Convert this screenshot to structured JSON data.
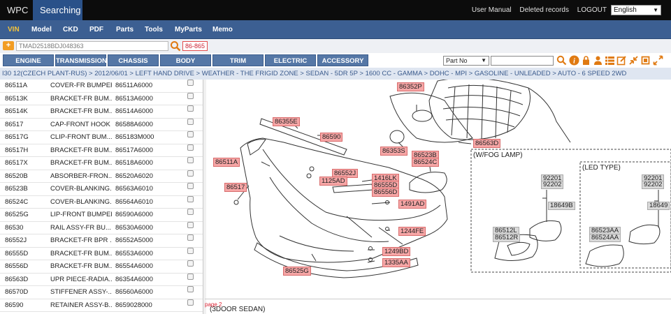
{
  "topbar": {
    "tabs": [
      "WPC",
      "Searching"
    ],
    "links": [
      "User Manual",
      "Deleted records",
      "LOGOUT"
    ],
    "language": "English"
  },
  "nav": [
    "VIN",
    "Model",
    "CKD",
    "PDF",
    "Parts",
    "Tools",
    "MyParts",
    "Memo"
  ],
  "search": {
    "add_label": "+",
    "vin_value": "TMAD2518BDJ048363",
    "range": "86-865"
  },
  "categories": [
    "ENGINE",
    "TRANSMISSION",
    "CHASSIS",
    "BODY",
    "TRIM",
    "ELECTRIC",
    "ACCESSORY"
  ],
  "part_select": "Part No",
  "breadcrumb": "I30 12(CZECH PLANT-RUS) > 2012/06/01 > LEFT HAND DRIVE > WEATHER - THE FRIGID ZONE > SEDAN - 5DR 5P > 1600 CC - GAMMA > DOHC - MPI > GASOLINE - UNLEADED > AUTO - 6 SPEED 2WD",
  "parts": [
    {
      "ref": "86511A",
      "name": "COVER-FR BUMPER",
      "pno": "86511A6000"
    },
    {
      "ref": "86513K",
      "name": "BRACKET-FR BUM...",
      "pno": "86513A6000"
    },
    {
      "ref": "86514K",
      "name": "BRACKET-FR BUM...",
      "pno": "86514A6000"
    },
    {
      "ref": "86517",
      "name": "CAP-FRONT HOOK",
      "pno": "86588A6000"
    },
    {
      "ref": "86517G",
      "name": "CLIP-FRONT BUM...",
      "pno": "865183M000"
    },
    {
      "ref": "86517H",
      "name": "BRACKET-FR BUM...",
      "pno": "86517A6000"
    },
    {
      "ref": "86517X",
      "name": "BRACKET-FR BUM...",
      "pno": "86518A6000"
    },
    {
      "ref": "86520B",
      "name": "ABSORBER-FRON...",
      "pno": "86520A6020"
    },
    {
      "ref": "86523B",
      "name": "COVER-BLANKING...",
      "pno": "86563A6010"
    },
    {
      "ref": "86524C",
      "name": "COVER-BLANKING...",
      "pno": "86564A6010"
    },
    {
      "ref": "86525G",
      "name": "LIP-FRONT BUMPER",
      "pno": "86590A6000"
    },
    {
      "ref": "86530",
      "name": "RAIL ASSY-FR BU...",
      "pno": "86530A6000"
    },
    {
      "ref": "86552J",
      "name": "BRACKET-FR BPR ...",
      "pno": "86552A5000"
    },
    {
      "ref": "86555D",
      "name": "BRACKET-FR BUM...",
      "pno": "86553A6000"
    },
    {
      "ref": "86556D",
      "name": "BRACKET-FR BUM...",
      "pno": "86554A6000"
    },
    {
      "ref": "86563D",
      "name": "UPR PIECE-RADIA...",
      "pno": "86354A6000"
    },
    {
      "ref": "86570D",
      "name": "STIFFENER ASSY-...",
      "pno": "86560A6000"
    },
    {
      "ref": "86590",
      "name": "RETAINER ASSY-B...",
      "pno": "8659028000"
    }
  ],
  "diagram": {
    "callouts": [
      "86352P",
      "86355E",
      "86590",
      "86511A",
      "86353S",
      "86563D",
      "86523B",
      "86524C",
      "86552J",
      "1125AD",
      "1416LK",
      "86555D",
      "86556D",
      "86517",
      "1491AD",
      "1244FE",
      "1249BD",
      "1335AA",
      "86525G"
    ],
    "fog_title": "(W/FOG LAMP)",
    "led_title": "(LED TYPE)",
    "fog_labels": [
      "92201",
      "92202",
      "18649B",
      "86512L",
      "86512R"
    ],
    "led_labels": [
      "92201",
      "92202",
      "18649",
      "86523AA",
      "86524AA"
    ],
    "page_label": "page 2",
    "bottom_title": "(3DOOR SEDAN)"
  }
}
